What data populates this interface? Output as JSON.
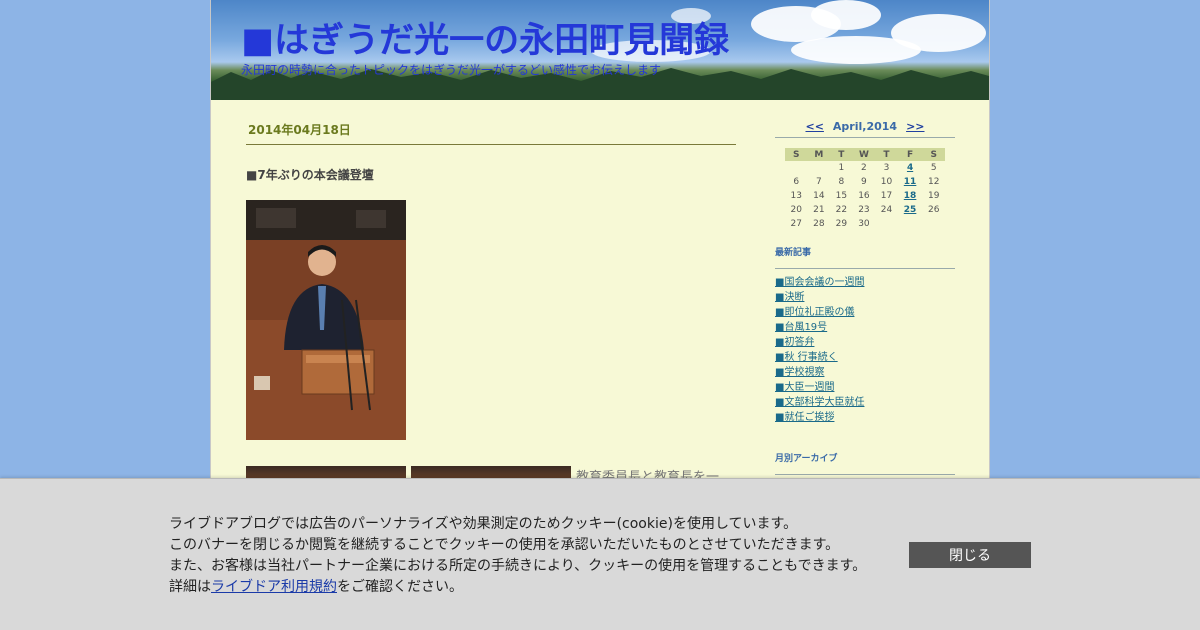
{
  "header": {
    "title": "■はぎうだ光一の永田町見聞録",
    "description": "永田町の時勢に合ったトピックをはぎうだ光一がするどい感性でお伝えします"
  },
  "post": {
    "date": "2014年04月18日",
    "title": "■7年ぶりの本会議登壇",
    "snippet": "教育委員長と教育長を一"
  },
  "calendar": {
    "prev": "<<",
    "month_label": "April,2014",
    "next": ">>",
    "weekdays": [
      "S",
      "M",
      "T",
      "W",
      "T",
      "F",
      "S"
    ],
    "weeks": [
      [
        "",
        "",
        "1",
        "2",
        "3",
        "4",
        "5"
      ],
      [
        "6",
        "7",
        "8",
        "9",
        "10",
        "11",
        "12"
      ],
      [
        "13",
        "14",
        "15",
        "16",
        "17",
        "18",
        "19"
      ],
      [
        "20",
        "21",
        "22",
        "23",
        "24",
        "25",
        "26"
      ],
      [
        "27",
        "28",
        "29",
        "30",
        "",
        "",
        ""
      ]
    ],
    "linked_days": [
      "4",
      "11",
      "18",
      "25"
    ]
  },
  "sidebar": {
    "recent_heading": "最新記事",
    "recent": [
      "■国会会議の一週間",
      "■決断",
      "■即位礼正殿の儀",
      "■台風19号",
      "■初答弁",
      "■秋 行事続く",
      "■学校視察",
      "■大臣一週間",
      "■文部科学大臣就任",
      "■就任ご挨拶"
    ],
    "archive_heading": "月別アーカイブ"
  },
  "cookie_banner": {
    "line1": "ライブドアブログでは広告のパーソナライズや効果測定のためクッキー(cookie)を使用しています。",
    "line2": "このバナーを閉じるか閲覧を継続することでクッキーの使用を承認いただいたものとさせていただきます。",
    "line3": "また、お客様は当社パートナー企業における所定の手続きにより、クッキーの使用を管理することもできます。",
    "line4_prefix": "詳細は",
    "line4_link": "ライブドア利用規約",
    "line4_suffix": "をご確認ください。",
    "close_label": "閉じる"
  }
}
